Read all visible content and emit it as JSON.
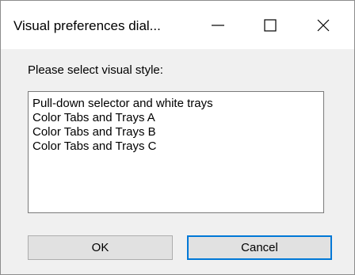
{
  "window": {
    "title": "Visual preferences dial...",
    "minimize_icon": "minimize-icon",
    "maximize_icon": "maximize-icon",
    "close_icon": "close-icon"
  },
  "dialog": {
    "prompt": "Please select visual style:",
    "styles": [
      "Pull-down selector and white trays",
      "Color Tabs and Trays A",
      "Color Tabs and Trays B",
      "Color Tabs and Trays C"
    ],
    "ok_label": "OK",
    "cancel_label": "Cancel"
  },
  "colors": {
    "focus_border": "#0078d7",
    "dialog_background": "#f0f0f0"
  }
}
